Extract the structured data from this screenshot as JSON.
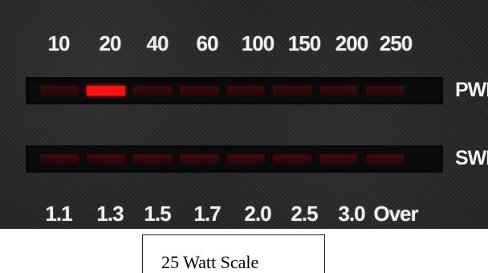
{
  "power_scale": [
    "10",
    "20",
    "40",
    "60",
    "100",
    "150",
    "200",
    "250"
  ],
  "swr_scale": [
    "1.1",
    "1.3",
    "1.5",
    "1.7",
    "2.0",
    "2.5",
    "3.0",
    "Over"
  ],
  "labels": {
    "pwr": "PWR",
    "swr": "SWR"
  },
  "power_meter": {
    "segments": 8,
    "lit_segment_index": 1,
    "lit_value": "20"
  },
  "swr_meter": {
    "segments": 8,
    "lit_segment_index": null
  },
  "colors": {
    "lit": "#ff1111",
    "unlit": "#3a0b0b",
    "panel": "#262626",
    "text": "#f0f0f0"
  },
  "caption": "25 Watt Scale"
}
